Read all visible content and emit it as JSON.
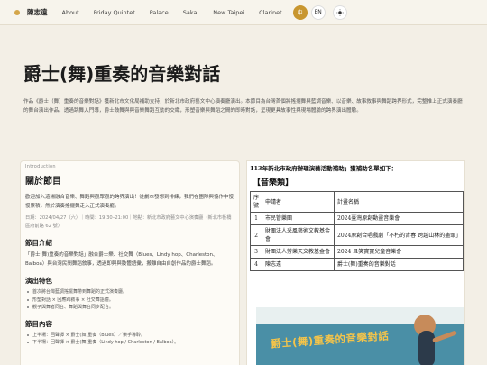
{
  "nav": {
    "brand": "陳志遠",
    "links": [
      "About",
      "Friday Quintet",
      "Palace",
      "Sakai",
      "New Taipei",
      "Clarinet"
    ],
    "lang_zh": "中",
    "lang_en": "EN",
    "theme_icon": "sun-icon"
  },
  "hero": {
    "title": "爵士(舞)重奏的音樂對話",
    "intro": "作品《爵士（舞）重奏的音樂對話》獲新北市文化局補助支持，於新北市政府藝文中心演奏廳演出。本節目為台灣首個將搖擺舞與藍調音樂、以音樂、故事敘事與舞蹈跨界形式，完整推上正式演奏廳的舞台演出作品。透過跳舞入門導，爵士鼓舞與與音樂舞蹈互動的交織，形塑音樂與舞蹈之間的即時對話，呈現更具故事性與現場體驗的跨界演出體驗。"
  },
  "card": {
    "eyebrow": "Introduction",
    "title": "關於節目",
    "body": "歡迎加入這場融合音樂、舞蹈與觀眾觀的跨界演出！從劇本發想到排練，我們在團隊與協作中慢慢累積，然於演奏搖擺舞走入正式演奏廳。",
    "meta": "日期：2024/04/27（六）｜時間：19:30–21:00｜地點：新北市政府藝文中心演奏廳（新北市板橋區府前路 62 號）",
    "section1_title": "節目介紹",
    "section1_text": "「爵士(舞)重奏的音樂對話」融合爵士樂、社交舞（Blues、Lindy hop、Charleston、Balboa）與台灣民間舞蹈敘事，透過即興與肢體語彙，搬離自由自創作品的爵士舞蹈。",
    "section2_title": "演出特色",
    "features": [
      "首次將台灣藍調搖擺舞帶到舞蹈的正式演奏廳。",
      "形塑對話 × 回應跨敘事 × 社交舞語體。",
      "觀子與舞者同台、舞蹈與舞台同步配合。"
    ],
    "section3_title": "節目內容",
    "program": [
      "上半場：回聲譚 × 爵士(舞)重奏（Blues）／樂手導聆。",
      "下半場：回聲譚 × 爵士(舞)重奏（Lindy hop / Charleston / Balboa）。"
    ]
  },
  "document": {
    "heading": "113年新北市政府辦理演藝活動補助」獲補助名單如下：",
    "category": "【音樂類】",
    "table": {
      "headers": [
        "序號",
        "申請者",
        "計畫名稱"
      ],
      "rows": [
        [
          "1",
          "市民管樂團",
          "2024臺灣原創動畫音樂會"
        ],
        [
          "2",
          "財團法人采風藝術文教基金會",
          "2024原創合唱戲劇「不朽的青春 跨越山林的盡頭」"
        ],
        [
          "3",
          "財團法人勞樂天文教基金會",
          "2024 且笑寶寶兒童音樂會"
        ],
        [
          "4",
          "陳志遠",
          "爵士(舞)重奏的音樂對話"
        ]
      ]
    },
    "poster_title": "爵士(舞)重奏的音樂對話"
  }
}
